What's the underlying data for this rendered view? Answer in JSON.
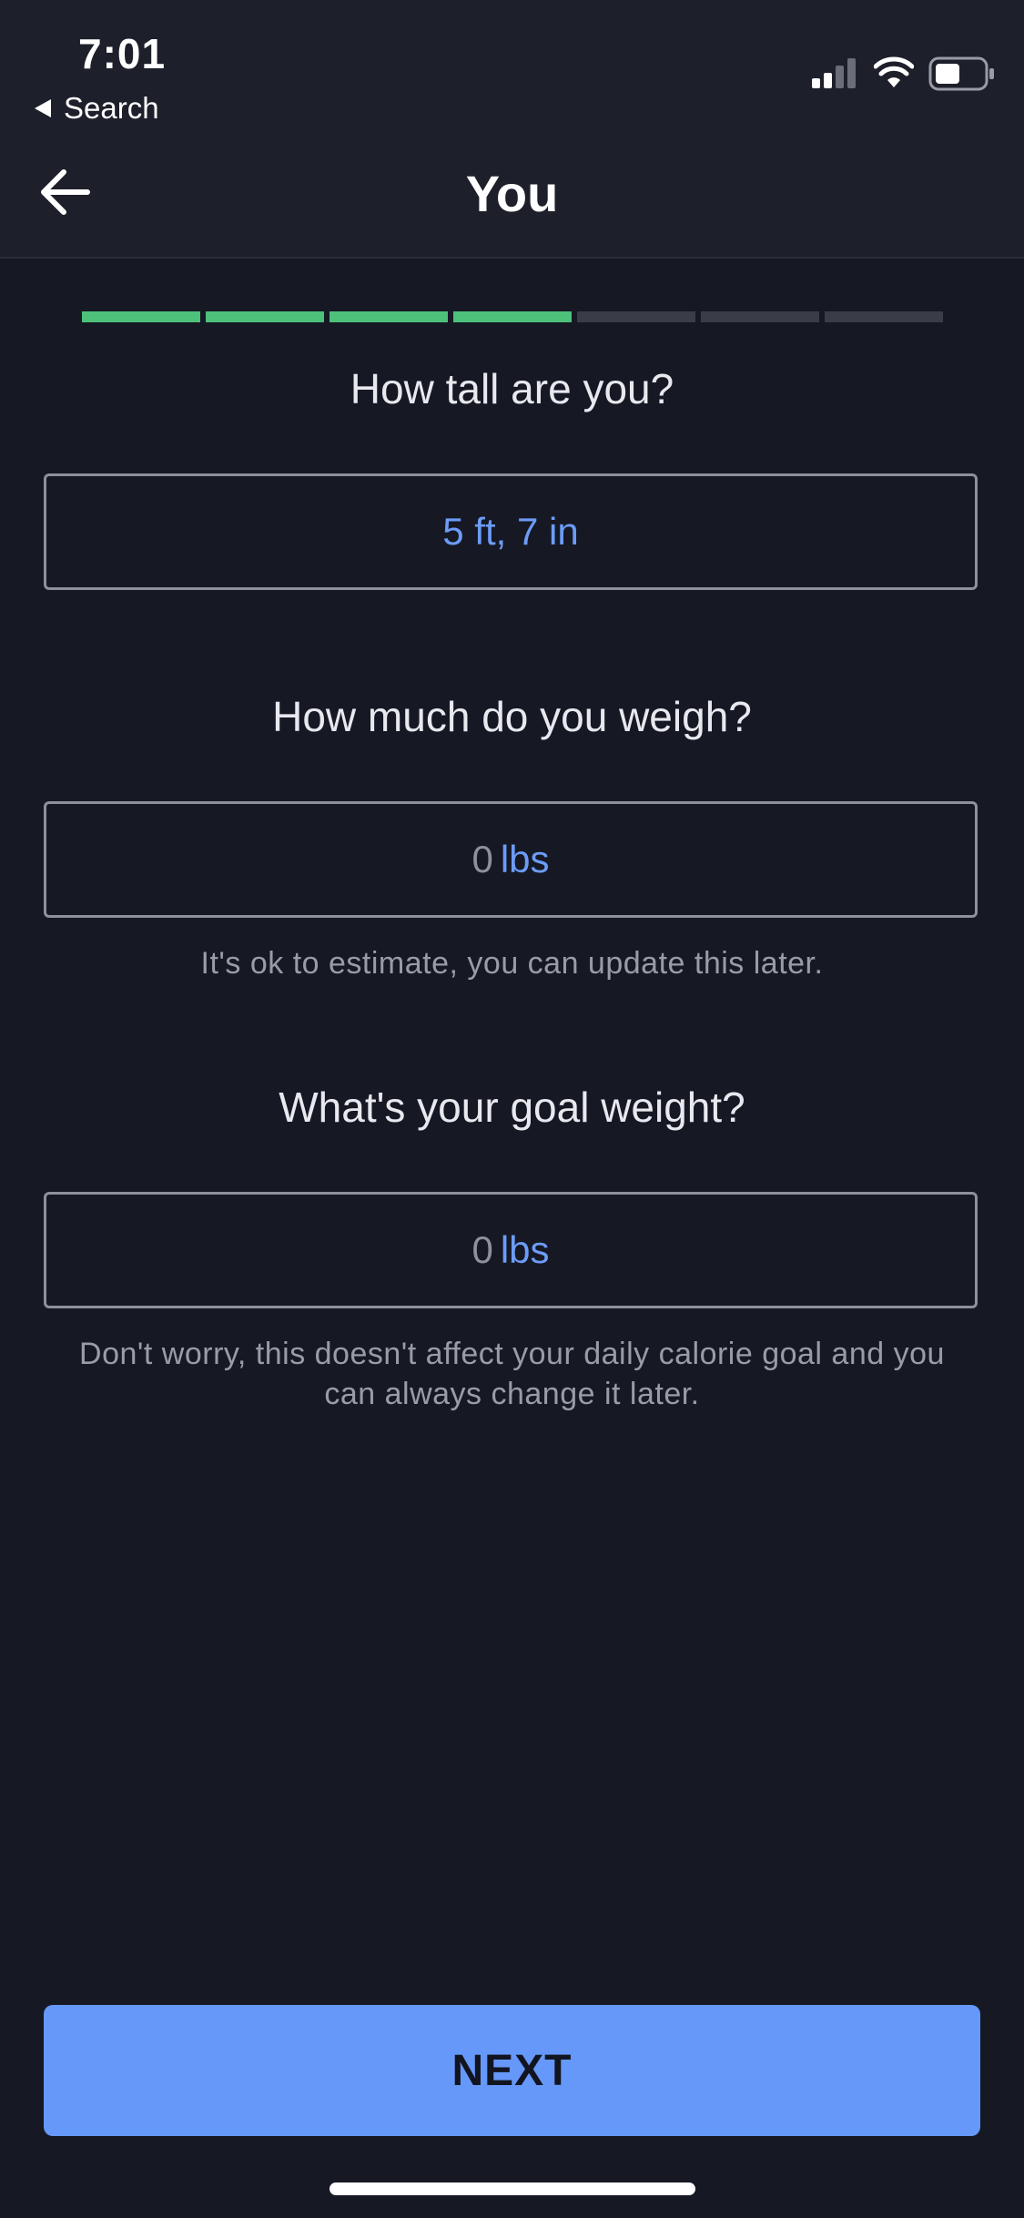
{
  "status_bar": {
    "time": "7:01",
    "back_label": "Search"
  },
  "header": {
    "title": "You"
  },
  "progress": {
    "total_steps": 7,
    "completed_steps": 4,
    "done_color": "#4dc07a",
    "pending_color": "#3a3d48"
  },
  "height": {
    "question": "How tall are you?",
    "value": "5 ft, 7 in"
  },
  "weight": {
    "question": "How much do you weigh?",
    "value": "0",
    "unit": "lbs",
    "hint": "It's ok to estimate, you can update this later."
  },
  "goal_weight": {
    "question": "What's your goal weight?",
    "value": "0",
    "unit": "lbs",
    "hint": "Don't worry, this doesn't affect your daily calorie goal and you can always change it later."
  },
  "footer": {
    "next_label": "NEXT"
  },
  "colors": {
    "accent": "#6598f8",
    "background": "#161824"
  }
}
